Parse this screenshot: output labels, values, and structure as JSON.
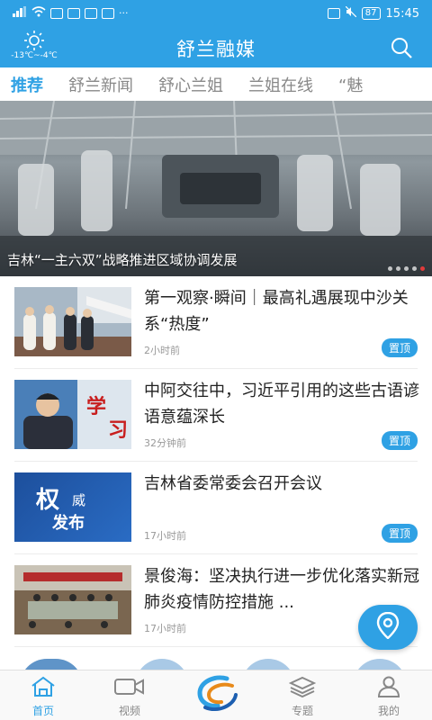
{
  "status_bar": {
    "signal": "4G",
    "battery": "87",
    "time": "15:45"
  },
  "header": {
    "title": "舒兰融媒",
    "weather_temp": "-13℃~-4℃",
    "weather_icon": "sun-icon",
    "search_icon": "search-icon"
  },
  "tabs": [
    {
      "label": "推荐",
      "active": true
    },
    {
      "label": "舒兰新闻",
      "active": false
    },
    {
      "label": "舒心兰姐",
      "active": false
    },
    {
      "label": "兰姐在线",
      "active": false
    },
    {
      "label": "“魅",
      "active": false
    }
  ],
  "banner": {
    "caption": "吉林“一主六双”战略推进区域协调发展",
    "slide_count": 5,
    "active_slide": 5
  },
  "news": [
    {
      "title": "第一观察·瞬间｜最高礼遇展现中沙关系“热度”",
      "time": "2小时前",
      "badge": "置顶",
      "thumb_text": ""
    },
    {
      "title": "中阿交往中，习近平引用的这些古语谚语意蕴深长",
      "time": "32分钟前",
      "badge": "置顶",
      "thumb_text": "学习"
    },
    {
      "title": "吉林省委常委会召开会议",
      "time": "17小时前",
      "badge": "置顶",
      "thumb_text": "权威发布"
    },
    {
      "title": "景俊海：坚决执行进一步优化落实新冠肺炎疫情防控措施 ...",
      "time": "17小时前",
      "badge": "",
      "thumb_text": ""
    }
  ],
  "thumb_texts": {
    "xuexi_1": "学",
    "xuexi_2": "习",
    "quanwei_1": "权",
    "quanwei_2": "威",
    "quanwei_3": "发布"
  },
  "bottom_nav": [
    {
      "label": "首页",
      "icon": "home-icon",
      "active": true
    },
    {
      "label": "视频",
      "icon": "video-camera-icon",
      "active": false
    },
    {
      "label": "",
      "icon": "app-logo-icon",
      "active": false
    },
    {
      "label": "专题",
      "icon": "layers-icon",
      "active": false
    },
    {
      "label": "我的",
      "icon": "user-icon",
      "active": false
    }
  ],
  "colors": {
    "brand": "#2fa1e4",
    "active_dot": "#e23b3b"
  }
}
